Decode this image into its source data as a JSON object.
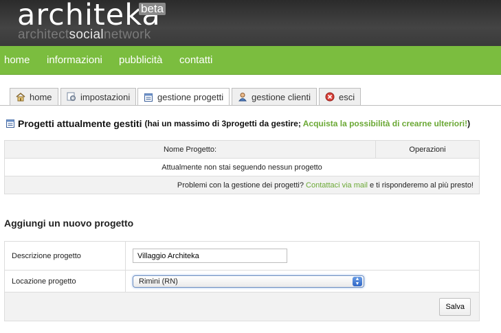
{
  "brand": {
    "logo": "architeka",
    "beta": "beta",
    "tagline_1": "architect",
    "tagline_2": "social",
    "tagline_3": "network"
  },
  "nav": [
    "home",
    "informazioni",
    "pubblicità",
    "contatti"
  ],
  "tabs": [
    {
      "label": "home",
      "icon": "house-icon"
    },
    {
      "label": "impostazioni",
      "icon": "settings-icon"
    },
    {
      "label": "gestione progetti",
      "icon": "document-icon",
      "active": true
    },
    {
      "label": "gestione clienti",
      "icon": "user-icon"
    },
    {
      "label": "esci",
      "icon": "close-circle-icon"
    }
  ],
  "projects": {
    "title": "Progetti attualmente gestiti",
    "subtitle_open": "(hai un massimo di 3progetti da gestire;",
    "subtitle_link": "Acquista la possibilità di crearne ulteriori!",
    "subtitle_close": ")",
    "columns": [
      "Nome Progetto:",
      "Operazioni"
    ],
    "empty_message": "Attualmente non stai seguendo nessun progetto",
    "help_prefix": "Problemi con la gestione dei progetti?",
    "help_link": "Contattaci via mail",
    "help_suffix": "e ti risponderemo al più presto!"
  },
  "add_project": {
    "title": "Aggiungi un nuovo progetto",
    "description_label": "Descrizione progetto",
    "description_value": "Villaggio Architeka",
    "location_label": "Locazione progetto",
    "location_value": "Rimini (RN)",
    "save_label": "Salva"
  },
  "colors": {
    "accent": "#7bbd3f",
    "link": "#6aa834",
    "header_bg": "#3a3a3a"
  }
}
